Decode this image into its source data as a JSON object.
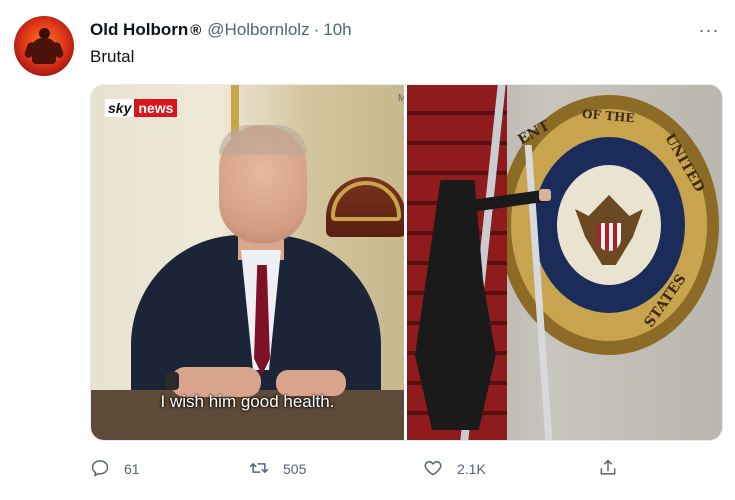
{
  "tweet": {
    "author_name": "Old Holborn",
    "author_mark": "®",
    "handle": "@Holbornlolz",
    "separator": "·",
    "timestamp": "10h",
    "text": "Brutal",
    "more_label": "···"
  },
  "media": {
    "left": {
      "logo_sky": "sky",
      "logo_news": "news",
      "caption": "I wish him good health.",
      "corner_mark": "M"
    },
    "right": {
      "seal_text_1": "ENT",
      "seal_text_2": "OF THE",
      "seal_text_3": "UNITED",
      "seal_text_4": "STATES"
    }
  },
  "actions": {
    "reply": {
      "icon": "reply-icon",
      "count": "61"
    },
    "retweet": {
      "icon": "retweet-icon",
      "count": "505"
    },
    "like": {
      "icon": "heart-icon",
      "count": "2.1K"
    },
    "share": {
      "icon": "share-icon"
    }
  },
  "colors": {
    "text": "#0f1419",
    "secondary": "#536471",
    "sky_news_red": "#d7161e"
  }
}
